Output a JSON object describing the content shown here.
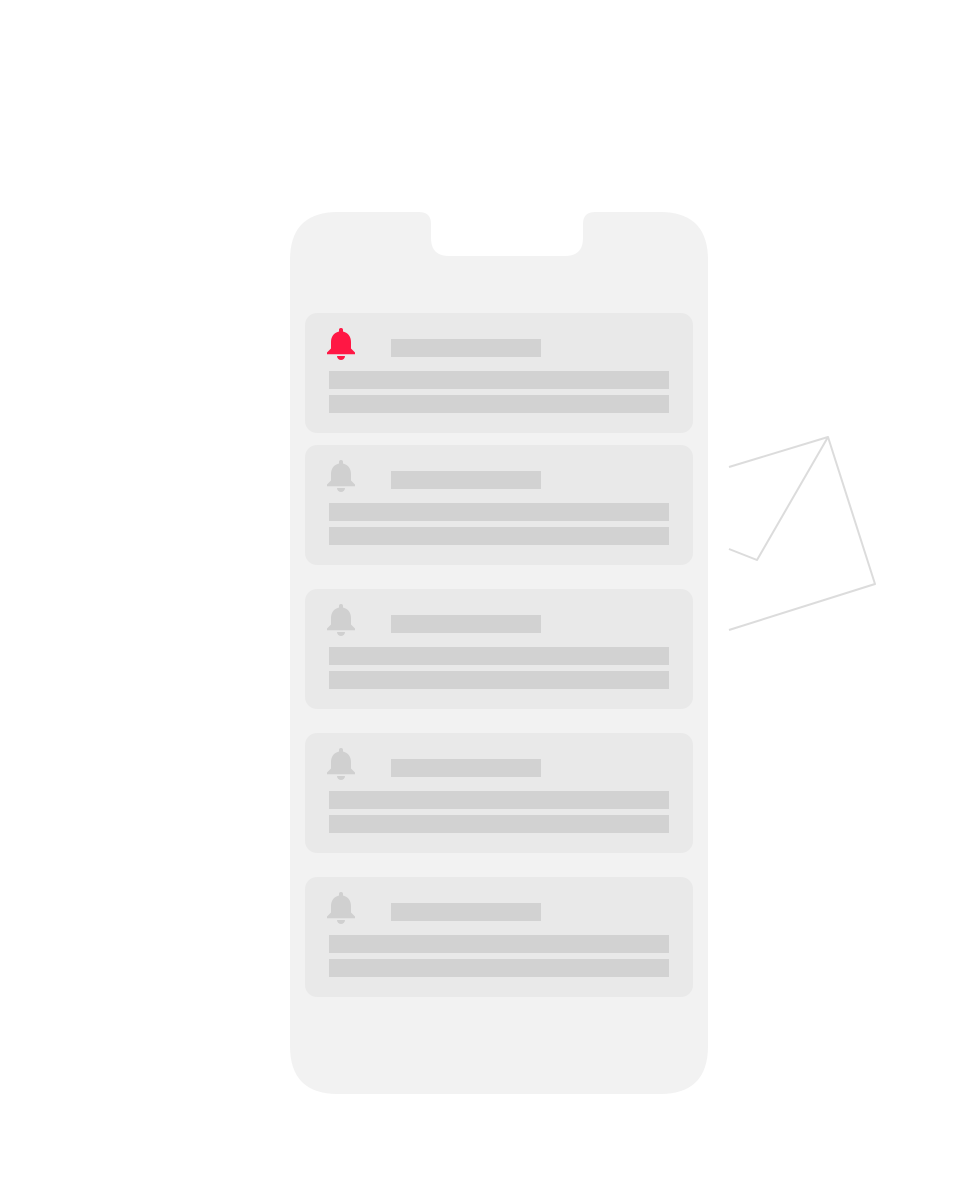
{
  "colors": {
    "background": "#ffffff",
    "phone_body": "#f2f2f2",
    "card": "#e9e9e9",
    "placeholder_bar": "#d2d2d2",
    "bell_active": "#ff1744",
    "bell_inactive": "#d0d0d0",
    "envelope_stroke": "#dcdcdc"
  },
  "notifications": [
    {
      "icon": "bell-icon",
      "state": "active"
    },
    {
      "icon": "bell-icon",
      "state": "inactive"
    },
    {
      "icon": "bell-icon",
      "state": "inactive"
    },
    {
      "icon": "bell-icon",
      "state": "inactive"
    },
    {
      "icon": "bell-icon",
      "state": "inactive"
    }
  ],
  "decoration": {
    "icon": "envelope-icon"
  }
}
